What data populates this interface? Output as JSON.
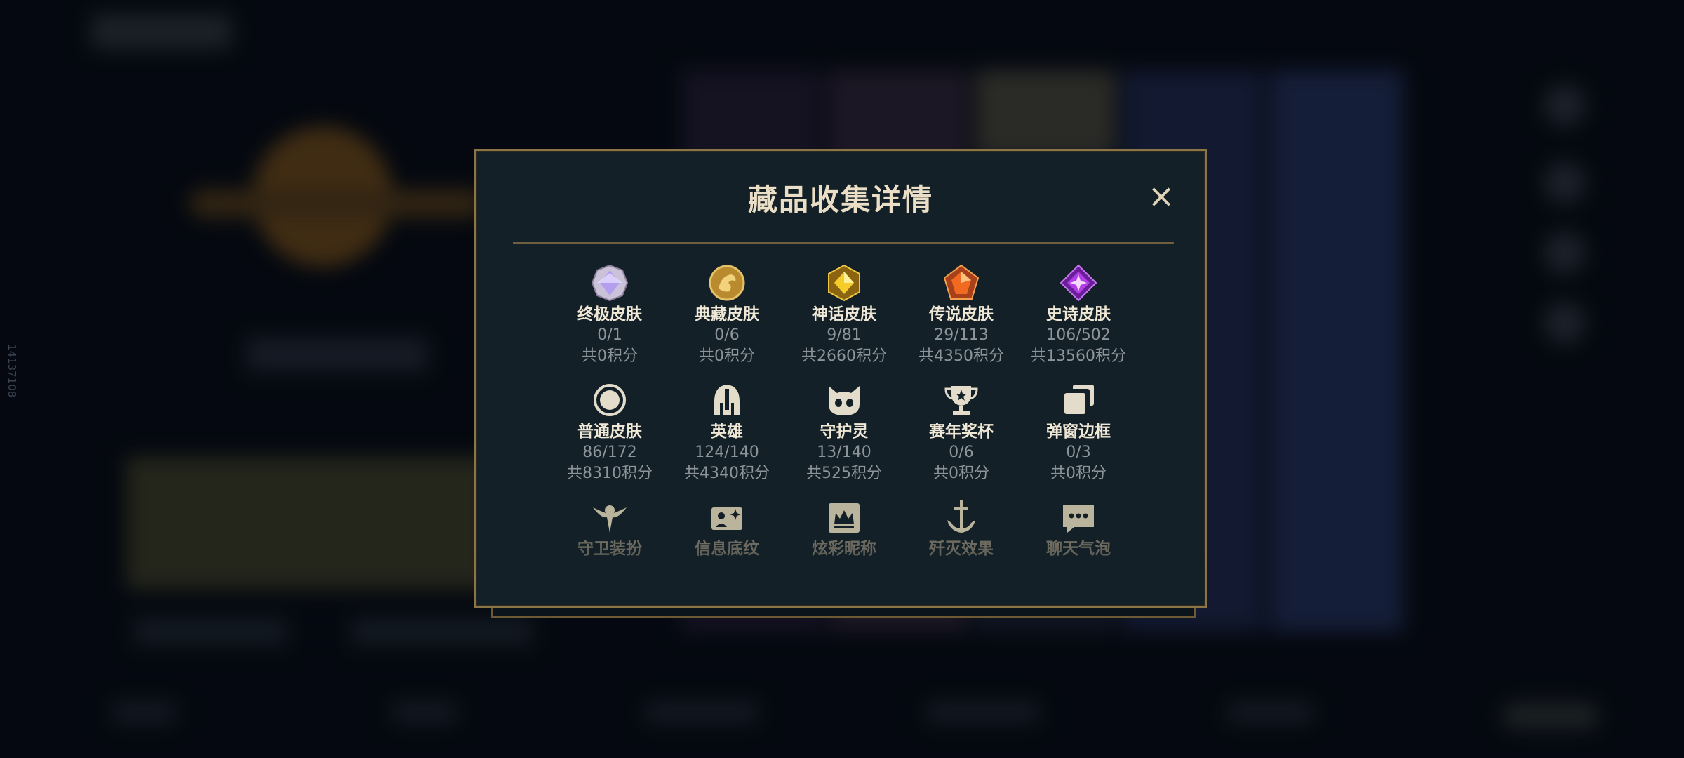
{
  "window": {
    "side_id": "14137108"
  },
  "modal": {
    "title": "藏品收集详情",
    "close_label": "×",
    "items": [
      {
        "name": "终极皮肤",
        "count": "0/1",
        "points": "共0积分",
        "icon": "ultimate-gem-icon"
      },
      {
        "name": "典藏皮肤",
        "count": "0/6",
        "points": "共0积分",
        "icon": "dragon-medallion-icon"
      },
      {
        "name": "神话皮肤",
        "count": "9/81",
        "points": "共2660积分",
        "icon": "mythic-gem-icon"
      },
      {
        "name": "传说皮肤",
        "count": "29/113",
        "points": "共4350积分",
        "icon": "legendary-gem-icon"
      },
      {
        "name": "史诗皮肤",
        "count": "106/502",
        "points": "共13560积分",
        "icon": "epic-gem-icon"
      },
      {
        "name": "普通皮肤",
        "count": "86/172",
        "points": "共8310积分",
        "icon": "ring-icon"
      },
      {
        "name": "英雄",
        "count": "124/140",
        "points": "共4340积分",
        "icon": "helmet-icon"
      },
      {
        "name": "守护灵",
        "count": "13/140",
        "points": "共525积分",
        "icon": "pet-face-icon"
      },
      {
        "name": "赛年奖杯",
        "count": "0/6",
        "points": "共0积分",
        "icon": "trophy-icon"
      },
      {
        "name": "弹窗边框",
        "count": "0/3",
        "points": "共0积分",
        "icon": "stacked-frames-icon"
      },
      {
        "name": "守卫装扮",
        "icon": "ward-icon"
      },
      {
        "name": "信息底纹",
        "icon": "card-sparkle-icon"
      },
      {
        "name": "炫彩昵称",
        "icon": "crown-card-icon"
      },
      {
        "name": "歼灭效果",
        "icon": "anchor-sword-icon"
      },
      {
        "name": "聊天气泡",
        "icon": "chat-bubble-icon"
      }
    ]
  },
  "colors": {
    "accent_gold": "#8b7446",
    "title_text": "#eadfc6",
    "muted_text": "#8d949a",
    "modal_bg": "#142027"
  }
}
